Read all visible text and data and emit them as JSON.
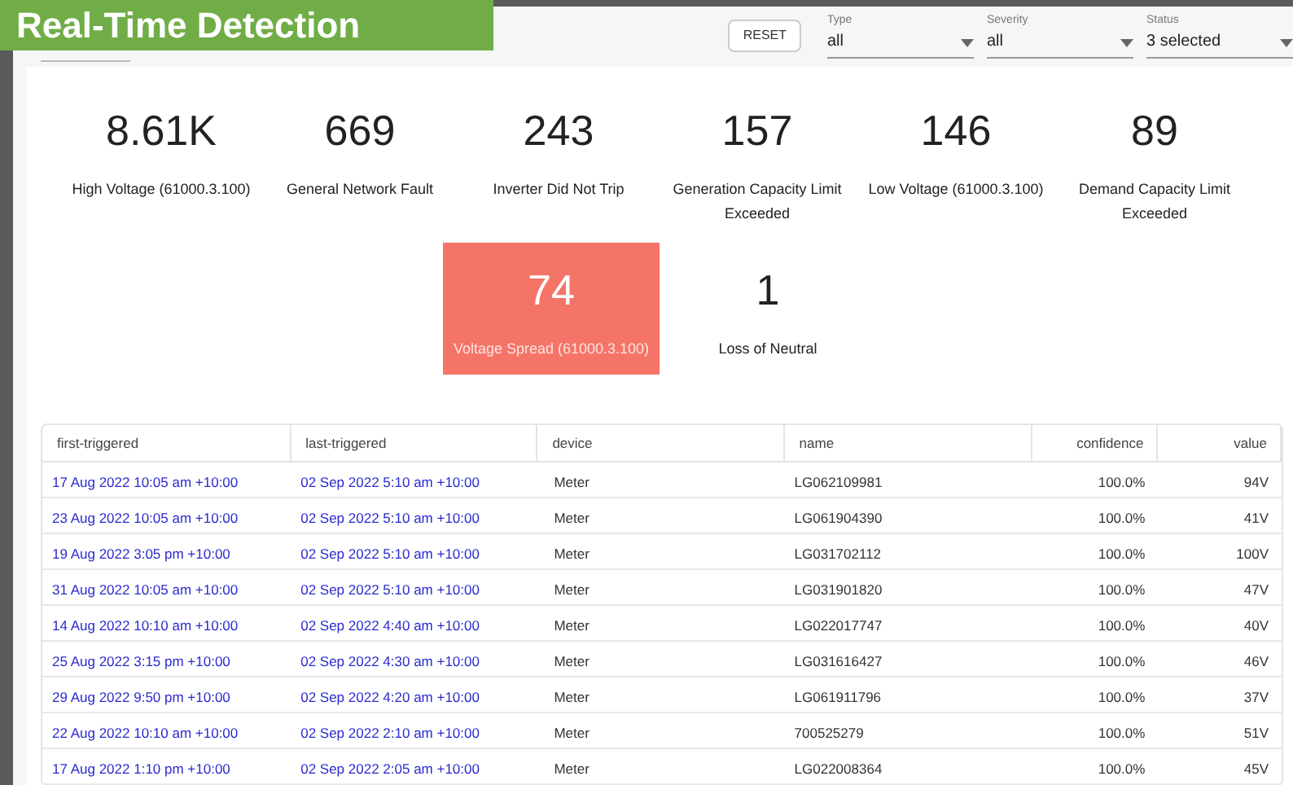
{
  "banner": {
    "title": "Real-Time Detection"
  },
  "toolbar": {
    "reset_button": "RESET",
    "filters": [
      {
        "label": "Type",
        "value": "all"
      },
      {
        "label": "Severity",
        "value": "all"
      },
      {
        "label": "Status",
        "value": "3 selected"
      }
    ]
  },
  "stats": [
    {
      "value": "8.61K",
      "label": "High Voltage (61000.3.100)",
      "selected": false
    },
    {
      "value": "669",
      "label": "General Network Fault",
      "selected": false
    },
    {
      "value": "243",
      "label": "Inverter Did Not Trip",
      "selected": false
    },
    {
      "value": "157",
      "label": "Generation Capacity Limit Exceeded",
      "selected": false
    },
    {
      "value": "146",
      "label": "Low Voltage (61000.3.100)",
      "selected": false
    },
    {
      "value": "89",
      "label": "Demand Capacity Limit Exceeded",
      "selected": false
    },
    {
      "value": "74",
      "label": "Voltage Spread (61000.3.100)",
      "selected": true
    },
    {
      "value": "1",
      "label": "Loss of Neutral",
      "selected": false
    }
  ],
  "table": {
    "columns": [
      "first-triggered",
      "last-triggered",
      "device",
      "name",
      "confidence",
      "value"
    ],
    "rows": [
      [
        "17 Aug 2022 10:05 am +10:00",
        "02 Sep 2022 5:10 am +10:00",
        "Meter",
        "LG062109981",
        "100.0%",
        "94V"
      ],
      [
        "23 Aug 2022 10:05 am +10:00",
        "02 Sep 2022 5:10 am +10:00",
        "Meter",
        "LG061904390",
        "100.0%",
        "41V"
      ],
      [
        "19 Aug 2022 3:05 pm +10:00",
        "02 Sep 2022 5:10 am +10:00",
        "Meter",
        "LG031702112",
        "100.0%",
        "100V"
      ],
      [
        "31 Aug 2022 10:05 am +10:00",
        "02 Sep 2022 5:10 am +10:00",
        "Meter",
        "LG031901820",
        "100.0%",
        "47V"
      ],
      [
        "14 Aug 2022 10:10 am +10:00",
        "02 Sep 2022 4:40 am +10:00",
        "Meter",
        "LG022017747",
        "100.0%",
        "40V"
      ],
      [
        "25 Aug 2022 3:15 pm +10:00",
        "02 Sep 2022 4:30 am +10:00",
        "Meter",
        "LG031616427",
        "100.0%",
        "46V"
      ],
      [
        "29 Aug 2022 9:50 pm +10:00",
        "02 Sep 2022 4:20 am +10:00",
        "Meter",
        "LG061911796",
        "100.0%",
        "37V"
      ],
      [
        "22 Aug 2022 10:10 am +10:00",
        "02 Sep 2022 2:10 am +10:00",
        "Meter",
        "700525279",
        "100.0%",
        "51V"
      ],
      [
        "17 Aug 2022 1:10 pm +10:00",
        "02 Sep 2022 2:05 am +10:00",
        "Meter",
        "LG022008364",
        "100.0%",
        "45V"
      ]
    ]
  }
}
